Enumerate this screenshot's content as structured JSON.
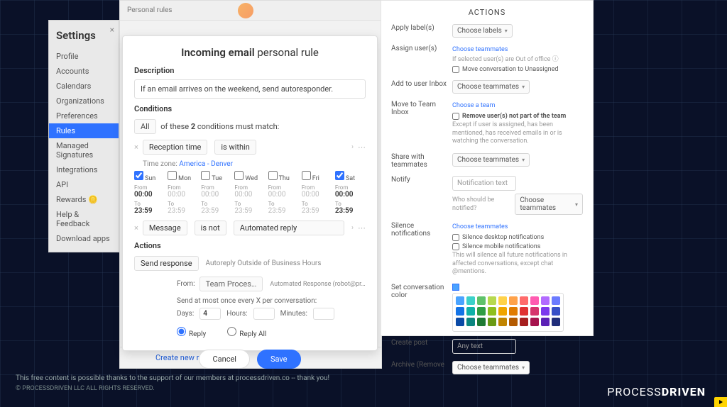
{
  "sidebar": {
    "title": "Settings",
    "items": [
      "Profile",
      "Accounts",
      "Calendars",
      "Organizations",
      "Preferences",
      "Rules",
      "Managed Signatures",
      "Integrations",
      "API",
      "Rewards 🪙",
      "Help & Feedback",
      "Download apps"
    ],
    "active_index": 5
  },
  "app_back": {
    "header": "Personal rules",
    "create_new": "Create new rule"
  },
  "modal": {
    "title_bold": "Incoming email",
    "title_rest": "personal rule",
    "desc_label": "Description",
    "desc_value": "If an email arrives on the weekend, send autoresponder.",
    "conditions_label": "Conditions",
    "match_prefix": "All",
    "match_mid": "of these",
    "match_count": "2",
    "match_suffix": "conditions must match:",
    "cond1_field": "Reception time",
    "cond1_op": "is within",
    "timezone_label": "Time zone:",
    "timezone_value": "America - Denver",
    "days": [
      {
        "label": "Sun",
        "checked": true,
        "from": "00:00",
        "to": "23:59"
      },
      {
        "label": "Mon",
        "checked": false,
        "from": "00:00",
        "to": "23:59"
      },
      {
        "label": "Tue",
        "checked": false,
        "from": "00:00",
        "to": "23:59"
      },
      {
        "label": "Wed",
        "checked": false,
        "from": "00:00",
        "to": "23:59"
      },
      {
        "label": "Thu",
        "checked": false,
        "from": "00:00",
        "to": "23:59"
      },
      {
        "label": "Fri",
        "checked": false,
        "from": "00:00",
        "to": "23:59"
      },
      {
        "label": "Sat",
        "checked": true,
        "from": "00:00",
        "to": "23:59"
      }
    ],
    "from_lbl": "From",
    "to_lbl": "To",
    "cond2_field": "Message",
    "cond2_op": "is not",
    "cond2_value": "Automated reply",
    "actions_label": "Actions",
    "action_type": "Send response",
    "action_template": "Autoreply Outside of Business Hours",
    "from_row_label": "From:",
    "from_team": "Team Proces…",
    "from_addr": "Automated Response (robot@pr…",
    "freq_label": "Send at most once every X per conversation:",
    "freq_days_label": "Days:",
    "freq_days_value": "4",
    "freq_hours_label": "Hours:",
    "freq_hours_value": "",
    "freq_minutes_label": "Minutes:",
    "freq_minutes_value": "",
    "reply": "Reply",
    "reply_all": "Reply All",
    "cancel": "Cancel",
    "save": "Save"
  },
  "actions_panel": {
    "title": "ACTIONS",
    "apply_labels": {
      "lab": "Apply label(s)",
      "sel": "Choose labels"
    },
    "assign_users": {
      "lab": "Assign user(s)",
      "hint": "Choose teammates",
      "note": "If selected user(s) are Out of office ⓘ",
      "chk": "Move conversation to Unassigned"
    },
    "add_inbox": {
      "lab": "Add to user Inbox",
      "sel": "Choose teammates"
    },
    "move_team": {
      "lab": "Move to Team Inbox",
      "hint": "Choose a team",
      "chk": "Remove user(s) not part of the team",
      "note": "Except if user is assigned, has been mentioned, has received emails in or is watching the conversation."
    },
    "share": {
      "lab": "Share with teammates",
      "sel": "Choose teammates"
    },
    "notify": {
      "lab": "Notify",
      "placeholder": "Notification text",
      "who": "Who should be notified?",
      "sel": "Choose teammates"
    },
    "silence": {
      "lab": "Silence notifications",
      "hint": "Choose teammates",
      "c1": "Silence desktop notifications",
      "c2": "Silence mobile notifications",
      "note": "This will silence all future notifications in affected conversations, except chat @mentions."
    },
    "color": {
      "lab": "Set conversation color"
    },
    "create_post": {
      "lab": "Create post",
      "placeholder": "Any text"
    },
    "archive": {
      "lab": "Archive (Remove",
      "sel": "Choose teammates"
    }
  },
  "colors": [
    [
      "#4aa3ff",
      "#3bd1c9",
      "#5ec26a",
      "#b7d94f",
      "#ffd24a",
      "#ffa24a",
      "#ff6b6b",
      "#ff5bb0",
      "#b26bff",
      "#6b7bff"
    ],
    [
      "#1373e6",
      "#0fb1a8",
      "#2f9e44",
      "#8fbf1f",
      "#f0a500",
      "#e07b00",
      "#e03131",
      "#d6336c",
      "#7c3aed",
      "#364fc7"
    ],
    [
      "#0a4aa6",
      "#0b867f",
      "#1e7a33",
      "#6a9a14",
      "#c08400",
      "#b35a00",
      "#a61e1e",
      "#a6134d",
      "#5b21b6",
      "#1f2d7a"
    ]
  ],
  "footer": {
    "line1": "This free content is possible thanks to the support of our members at processdriven.co -- thank you!",
    "line2": "© PROCESSDRIVEN LLC ALL RIGHTS RESERVED.",
    "brand1": "PROCESS",
    "brand2": "DRIVEN"
  }
}
